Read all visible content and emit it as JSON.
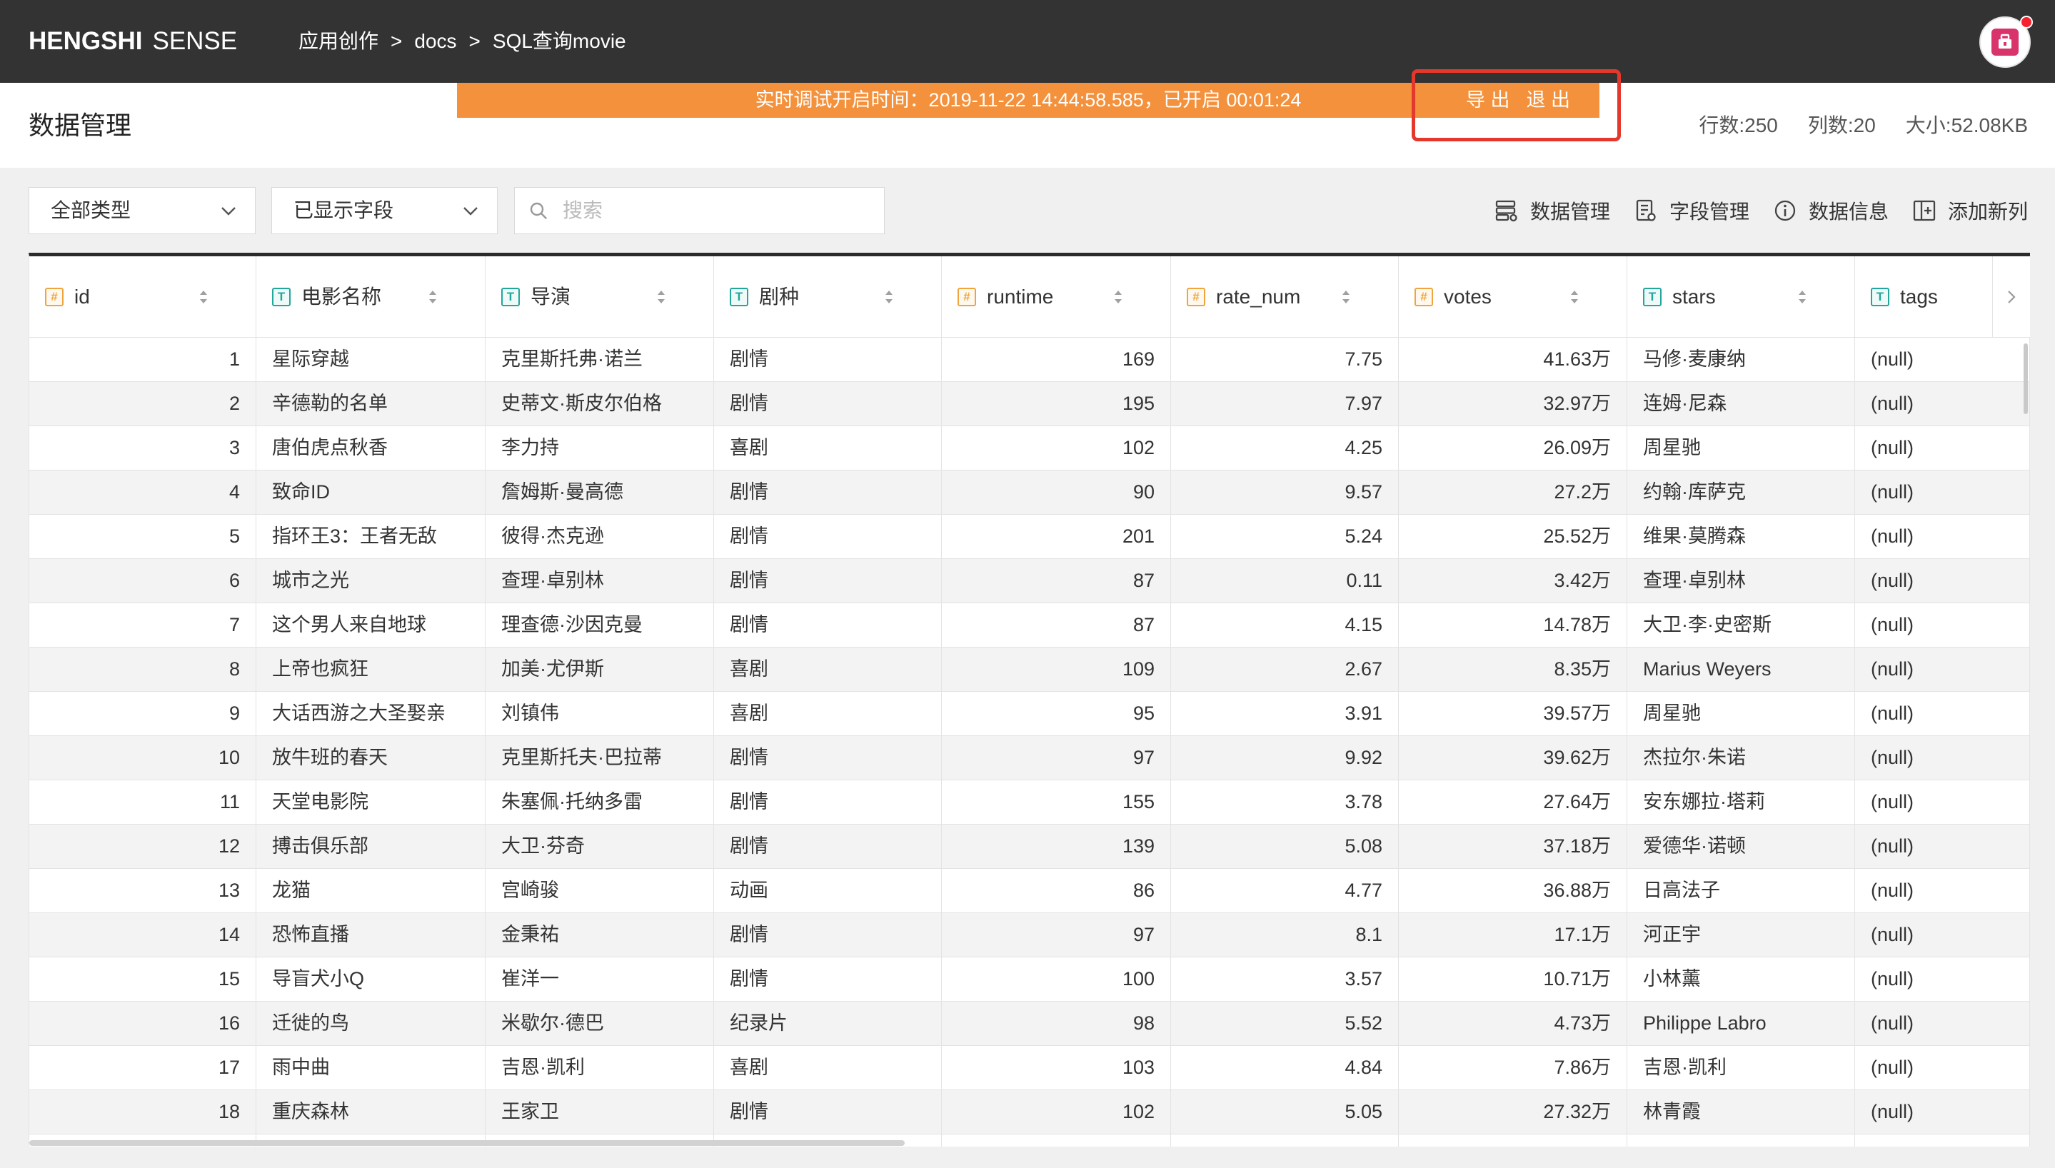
{
  "app": {
    "brand_bold": "HENGSHI",
    "brand_light": "SENSE"
  },
  "breadcrumb": {
    "items": [
      "应用创作",
      "docs",
      "SQL查询movie"
    ],
    "separator": ">"
  },
  "debug_bar": {
    "message": "实时调试开启时间：2019-11-22 14:44:58.585，已开启 00:01:24",
    "export_label": "导 出",
    "exit_label": "退 出"
  },
  "page": {
    "title": "数据管理"
  },
  "stats": {
    "rows": "行数:250",
    "cols": "列数:20",
    "size": "大小:52.08KB"
  },
  "filters": {
    "type_select": "全部类型",
    "field_select": "已显示字段",
    "search_placeholder": "搜索"
  },
  "tools": [
    {
      "label": "数据管理",
      "icon": "data-manage-icon"
    },
    {
      "label": "字段管理",
      "icon": "field-manage-icon"
    },
    {
      "label": "数据信息",
      "icon": "info-icon"
    },
    {
      "label": "添加新列",
      "icon": "add-column-icon"
    }
  ],
  "table": {
    "columns": [
      {
        "label": "id",
        "icon": "#",
        "type": "number"
      },
      {
        "label": "电影名称",
        "icon": "T",
        "type": "text"
      },
      {
        "label": "导演",
        "icon": "T",
        "type": "text"
      },
      {
        "label": "剧种",
        "icon": "T",
        "type": "text"
      },
      {
        "label": "runtime",
        "icon": "#",
        "type": "number"
      },
      {
        "label": "rate_num",
        "icon": "#",
        "type": "number"
      },
      {
        "label": "votes",
        "icon": "#",
        "type": "number"
      },
      {
        "label": "stars",
        "icon": "T",
        "type": "text"
      },
      {
        "label": "tags",
        "icon": "T",
        "type": "text"
      }
    ],
    "rows": [
      [
        1,
        "星际穿越",
        "克里斯托弗·诺兰",
        "剧情",
        169,
        7.75,
        "41.63万",
        "马修·麦康纳",
        "(null)"
      ],
      [
        2,
        "辛德勒的名单",
        "史蒂文·斯皮尔伯格",
        "剧情",
        195,
        7.97,
        "32.97万",
        "连姆·尼森",
        "(null)"
      ],
      [
        3,
        "唐伯虎点秋香",
        "李力持",
        "喜剧",
        102,
        4.25,
        "26.09万",
        "周星驰",
        "(null)"
      ],
      [
        4,
        "致命ID",
        "詹姆斯·曼高德",
        "剧情",
        90,
        9.57,
        "27.2万",
        "约翰·库萨克",
        "(null)"
      ],
      [
        5,
        "指环王3：王者无敌",
        "彼得·杰克逊",
        "剧情",
        201,
        5.24,
        "25.52万",
        "维果·莫腾森",
        "(null)"
      ],
      [
        6,
        "城市之光",
        "查理·卓别林",
        "剧情",
        87,
        0.11,
        "3.42万",
        "查理·卓别林",
        "(null)"
      ],
      [
        7,
        "这个男人来自地球",
        "理查德·沙因克曼",
        "剧情",
        87,
        4.15,
        "14.78万",
        "大卫·李·史密斯",
        "(null)"
      ],
      [
        8,
        "上帝也疯狂",
        "加美·尤伊斯",
        "喜剧",
        109,
        2.67,
        "8.35万",
        "Marius Weyers",
        "(null)"
      ],
      [
        9,
        "大话西游之大圣娶亲",
        "刘镇伟",
        "喜剧",
        95,
        3.91,
        "39.57万",
        "周星驰",
        "(null)"
      ],
      [
        10,
        "放牛班的春天",
        "克里斯托夫·巴拉蒂",
        "剧情",
        97,
        9.92,
        "39.62万",
        "杰拉尔·朱诺",
        "(null)"
      ],
      [
        11,
        "天堂电影院",
        "朱塞佩·托纳多雷",
        "剧情",
        155,
        3.78,
        "27.64万",
        "安东娜拉·塔莉",
        "(null)"
      ],
      [
        12,
        "搏击俱乐部",
        "大卫·芬奇",
        "剧情",
        139,
        5.08,
        "37.18万",
        "爱德华·诺顿",
        "(null)"
      ],
      [
        13,
        "龙猫",
        "宫崎骏",
        "动画",
        86,
        4.77,
        "36.88万",
        "日高法子",
        "(null)"
      ],
      [
        14,
        "恐怖直播",
        "金秉祐",
        "剧情",
        97,
        8.1,
        "17.1万",
        "河正宇",
        "(null)"
      ],
      [
        15,
        "导盲犬小Q",
        "崔洋一",
        "剧情",
        100,
        3.57,
        "10.71万",
        "小林薰",
        "(null)"
      ],
      [
        16,
        "迁徙的鸟",
        "米歇尔·德巴",
        "纪录片",
        98,
        5.52,
        "4.73万",
        "Philippe Labro",
        "(null)"
      ],
      [
        17,
        "雨中曲",
        "吉恩·凯利",
        "喜剧",
        103,
        4.84,
        "7.86万",
        "吉恩·凯利",
        "(null)"
      ],
      [
        18,
        "重庆森林",
        "王家卫",
        "剧情",
        102,
        5.05,
        "27.32万",
        "林青霞",
        "(null)"
      ]
    ]
  },
  "colors": {
    "topbar": "#333333",
    "debug_bar": "#f4913c",
    "highlight_box": "#e5382d",
    "number_type": "#f0a43c",
    "text_type": "#21a79b",
    "page_bg": "#f0f0f0",
    "table_top_border": "#2b2b2b",
    "avatar": "#d8336a",
    "notification": "#f5222d"
  }
}
